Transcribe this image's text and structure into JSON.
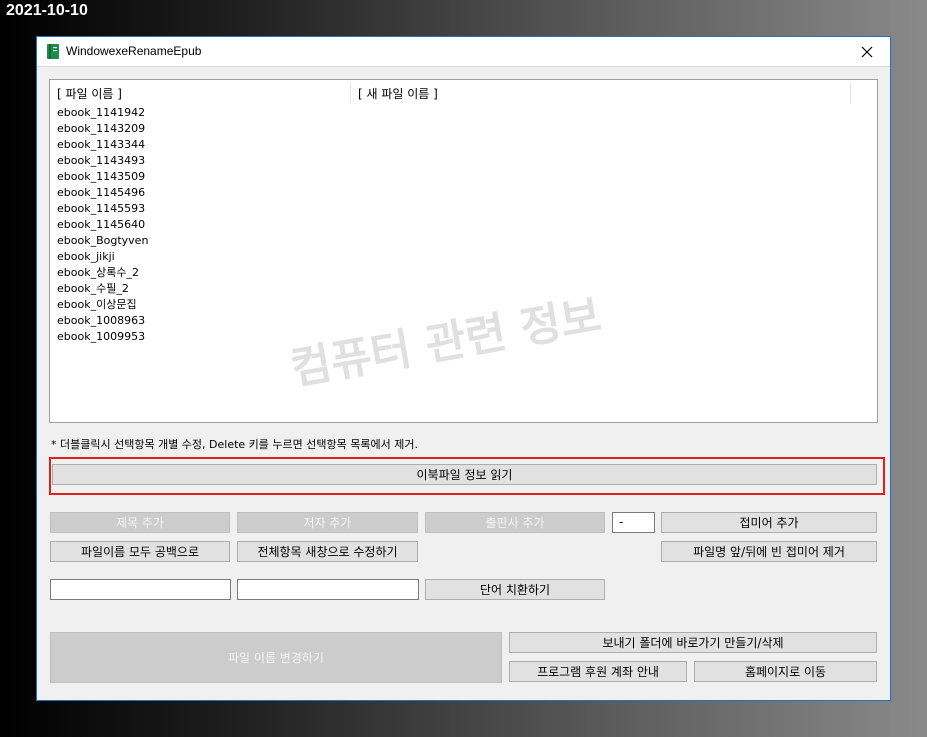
{
  "date_stamp": "2021-10-10",
  "window": {
    "title": "WindowexeRenameEpub",
    "close_symbol": "✕"
  },
  "list": {
    "col_file_name": "[ 파일 이름 ]",
    "col_new_file_name": "[ 새 파일 이름 ]",
    "items": [
      "ebook_1141942",
      "ebook_1143209",
      "ebook_1143344",
      "ebook_1143493",
      "ebook_1143509",
      "ebook_1145496",
      "ebook_1145593",
      "ebook_1145640",
      "ebook_Bogtyven",
      "ebook_jikji",
      "ebook_상록수_2",
      "ebook_수필_2",
      "ebook_이상문집",
      "ebook_1008963",
      "ebook_1009953"
    ]
  },
  "watermark": "컴퓨터 관련 정보",
  "hint": "* 더블클릭시 선택항목 개별 수정, Delete 키를 누르면 선택항목 목록에서 제거.",
  "buttons": {
    "read_info": "이북파일 정보 읽기",
    "add_title": "제목 추가",
    "add_author": "저자 추가",
    "add_publisher": "출판사 추가",
    "add_suffix": "접미어 추가",
    "all_spaces": "파일이름 모두 공백으로",
    "edit_all_new_window": "전체항목 새창으로 수정하기",
    "remove_empty_affix": "파일명 앞/뒤에 빈 접미어 제거",
    "replace_word": "단어 치환하기",
    "rename_files": "파일 이름 변경하기",
    "sendto_shortcut": "보내기 폴더에 바로가기 만들기/삭제",
    "donation": "프로그램 후원 계좌 안내",
    "homepage": "홈페이지로 이동"
  },
  "inputs": {
    "separator_value": "-",
    "find_value": "",
    "replace_value": ""
  },
  "colors": {
    "titlebar_border": "#1a73c6",
    "highlight": "#e0201b",
    "app_icon": "#1f8a4c"
  }
}
